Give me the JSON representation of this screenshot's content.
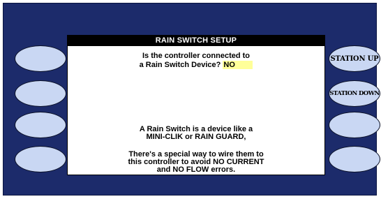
{
  "screen": {
    "title": "RAIN SWITCH SETUP",
    "question_line1": "Is the controller connected to",
    "question_line2_prefix": "a Rain Switch Device?",
    "answer_value": "NO",
    "info_line1": "A Rain Switch is a device like a",
    "info_line2": "MINI-CLIK or RAIN GUARD,",
    "info_line3": "There's a special way to wire them to",
    "info_line4": "this controller to avoid NO CURRENT",
    "info_line5": "and NO FLOW errors."
  },
  "right_buttons": {
    "station_up_label": "STATION UP",
    "station_down_label": "STATION DOWN"
  },
  "colors": {
    "frame": "#1c2b6b",
    "button": "#c9d7f3",
    "highlight": "#ffff99",
    "title_bar": "#000000"
  }
}
